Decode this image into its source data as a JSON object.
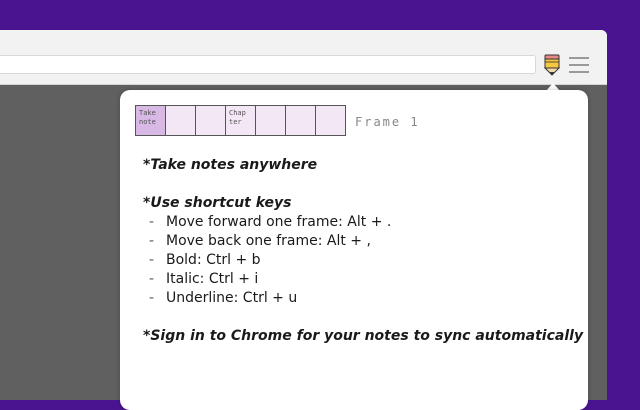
{
  "browser": {
    "address": "",
    "extension_icon": "pencil-note-icon",
    "menu_icon": "hamburger-menu-icon"
  },
  "popup": {
    "frames": [
      {
        "text": "Take note",
        "active": true
      },
      {
        "text": "",
        "active": false
      },
      {
        "text": "",
        "active": false
      },
      {
        "text": "Chap ter",
        "active": false
      },
      {
        "text": "",
        "active": false
      },
      {
        "text": "",
        "active": false
      },
      {
        "text": "",
        "active": false
      }
    ],
    "frame_label": "Frame 1",
    "notes": {
      "heading1": "*Take notes anywhere",
      "heading2": "*Use shortcut keys",
      "shortcuts": [
        "Move forward one frame: Alt + .",
        "Move back one frame: Alt + ,",
        "Bold: Ctrl + b",
        "Italic: Ctrl + i",
        "Underline: Ctrl + u"
      ],
      "dash": "-",
      "footer": "*Sign in to Chrome for your notes to sync automatically"
    }
  },
  "colors": {
    "background": "#4a1490",
    "toolbar": "#f2f2f2",
    "page": "#606060",
    "frame_active": "#d8b8e4",
    "frame_inactive": "#f3e6f5",
    "pencil_body": "#f5c842",
    "pencil_tip": "#e88a8a"
  }
}
